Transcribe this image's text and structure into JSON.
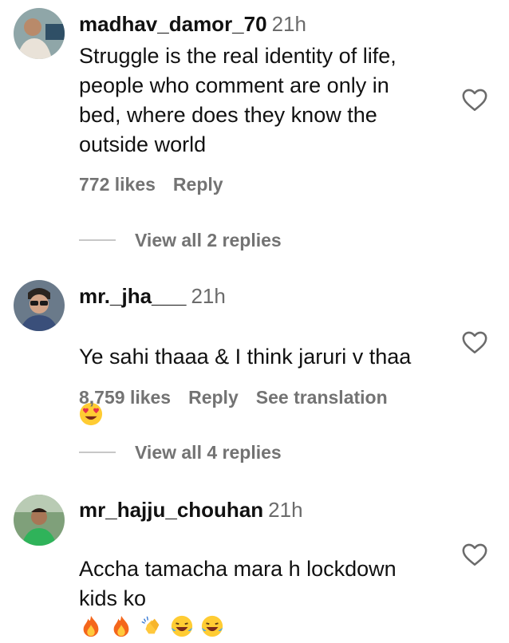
{
  "comments": [
    {
      "username": "madhav_damor_70",
      "time": "21h",
      "text": "Struggle is the real identity of life,\npeople who comment are only in\nbed, where does they know the\noutside world",
      "likes": "772 likes",
      "reply": "Reply",
      "view_replies": "View all 2 replies",
      "avatar_icon": "avatar-man-icon"
    },
    {
      "username": "mr._jha___",
      "time": "21h",
      "text": "Ye sahi thaaa & I think jaruri v thaa",
      "emojis": [
        "heart-eyes-emoji"
      ],
      "likes": "8,759 likes",
      "reply": "Reply",
      "translation": "See translation",
      "view_replies": "View all 4 replies",
      "avatar_icon": "avatar-sunglasses-icon"
    },
    {
      "username": "mr_hajju_chouhan",
      "time": "21h",
      "text": "Accha tamacha mara h lockdown\nkids ko",
      "emojis": [
        "fire-emoji",
        "fire-emoji",
        "clapping-hands-emoji",
        "laughing-tears-emoji",
        "laughing-tears-emoji"
      ],
      "avatar_icon": "avatar-outdoor-icon"
    }
  ],
  "colors": {
    "text": "#111111",
    "muted": "#737373",
    "line": "#c7c7c7"
  }
}
